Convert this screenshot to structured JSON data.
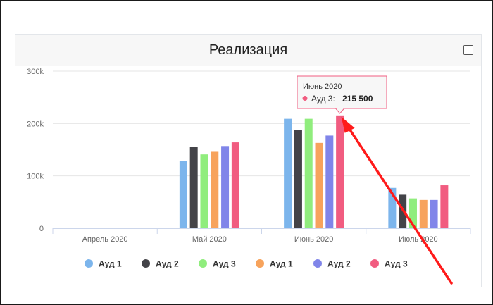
{
  "page": {
    "title": "Реализация"
  },
  "chart_data": {
    "type": "bar",
    "title": "Реализация",
    "categories": [
      "Апрель 2020",
      "Май 2020",
      "Июнь 2020",
      "Июль 2020"
    ],
    "series": [
      {
        "name": "Ауд 1",
        "color": "#7cb5ec",
        "values": [
          0,
          129000,
          209000,
          77000
        ]
      },
      {
        "name": "Ауд 2",
        "color": "#434348",
        "values": [
          0,
          156000,
          187000,
          64000
        ]
      },
      {
        "name": "Ауд 3",
        "color": "#90ed7d",
        "values": [
          0,
          141000,
          209000,
          57000
        ]
      },
      {
        "name": "Ауд 1",
        "color": "#f7a35c",
        "values": [
          0,
          146000,
          163000,
          54000
        ]
      },
      {
        "name": "Ауд 2",
        "color": "#8085e9",
        "values": [
          0,
          157000,
          177000,
          54000
        ]
      },
      {
        "name": "Ауд 3",
        "color": "#f15c80",
        "values": [
          0,
          164000,
          215500,
          82000
        ]
      }
    ],
    "yticks": [
      "0",
      "100k",
      "200k",
      "300k"
    ],
    "ylim": [
      0,
      300000
    ],
    "grid": true,
    "legend": "bottom",
    "tooltip": {
      "title": "Июнь 2020",
      "series_label": "Ауд 3:",
      "value_label": "215 500",
      "category_index": 2,
      "series_index": 5
    }
  },
  "annotation": {
    "arrow_color": "#ff1a1a"
  }
}
